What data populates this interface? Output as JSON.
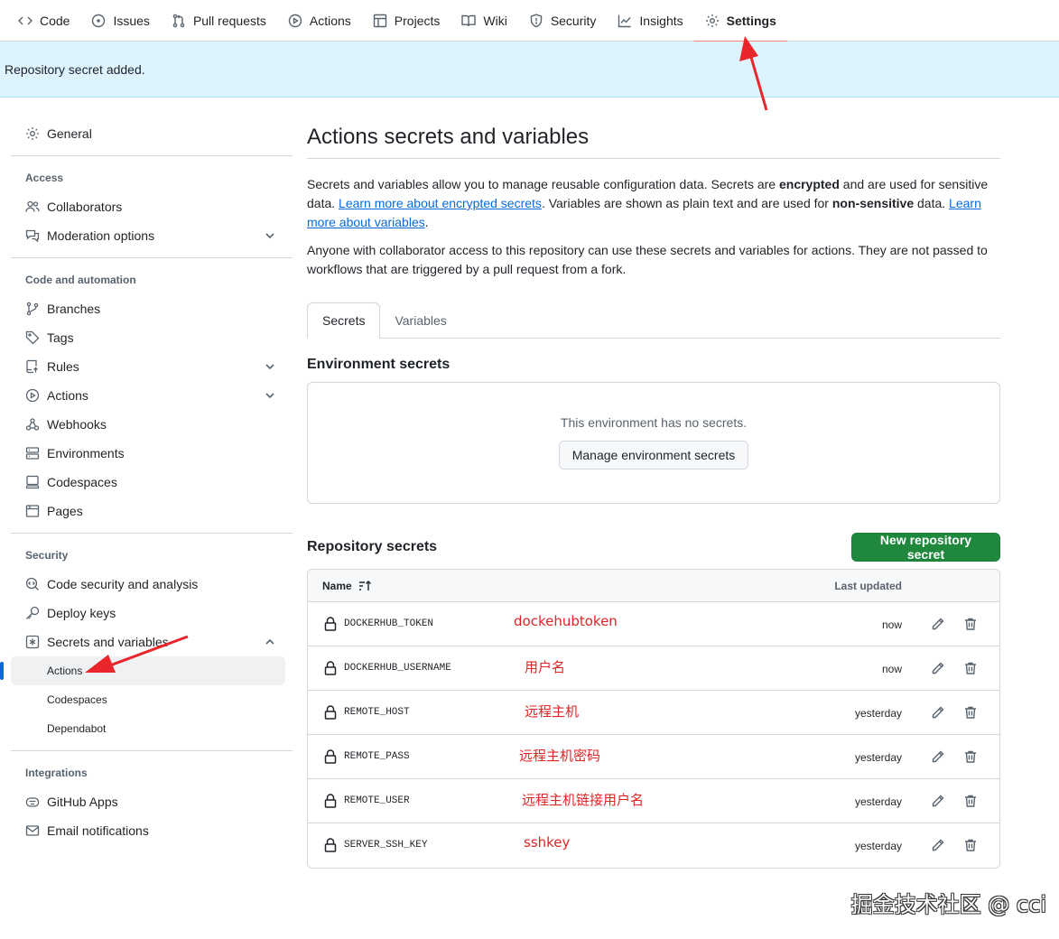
{
  "nav": {
    "items": [
      {
        "label": "Code",
        "icon": "code-icon"
      },
      {
        "label": "Issues",
        "icon": "issue-icon"
      },
      {
        "label": "Pull requests",
        "icon": "pull-request-icon"
      },
      {
        "label": "Actions",
        "icon": "play-icon"
      },
      {
        "label": "Projects",
        "icon": "table-icon"
      },
      {
        "label": "Wiki",
        "icon": "book-icon"
      },
      {
        "label": "Security",
        "icon": "shield-icon"
      },
      {
        "label": "Insights",
        "icon": "graph-icon"
      },
      {
        "label": "Settings",
        "icon": "gear-icon"
      }
    ],
    "active": "Settings"
  },
  "flash": {
    "message": "Repository secret added."
  },
  "sidebar": {
    "general": "General",
    "access_heading": "Access",
    "collaborators": "Collaborators",
    "moderation": "Moderation options",
    "code_heading": "Code and automation",
    "branches": "Branches",
    "tags": "Tags",
    "rules": "Rules",
    "actions": "Actions",
    "webhooks": "Webhooks",
    "environments": "Environments",
    "codespaces": "Codespaces",
    "pages": "Pages",
    "security_heading": "Security",
    "code_security": "Code security and analysis",
    "deploy_keys": "Deploy keys",
    "secrets_vars": "Secrets and variables",
    "sub_actions": "Actions",
    "sub_codespaces": "Codespaces",
    "sub_dependabot": "Dependabot",
    "integrations_heading": "Integrations",
    "github_apps": "GitHub Apps",
    "email_notifications": "Email notifications"
  },
  "main": {
    "title": "Actions secrets and variables",
    "desc_1": "Secrets and variables allow you to manage reusable configuration data. Secrets are ",
    "desc_bold_1": "encrypted",
    "desc_2": " and are used for sensitive data. ",
    "desc_link_1": "Learn more about encrypted secrets",
    "desc_3": ". Variables are shown as plain text and are used for ",
    "desc_bold_2": "non-sensitive",
    "desc_4": " data. ",
    "desc_link_2": "Learn more about variables",
    "desc_5": ".",
    "desc_second": "Anyone with collaborator access to this repository can use these secrets and variables for actions. They are not passed to workflows that are triggered by a pull request from a fork.",
    "tab_secrets": "Secrets",
    "tab_variables": "Variables",
    "env_title": "Environment secrets",
    "env_empty": "This environment has no secrets.",
    "env_button": "Manage environment secrets",
    "repo_title": "Repository secrets",
    "new_button": "New repository secret",
    "col_name": "Name",
    "col_updated": "Last updated"
  },
  "secrets": [
    {
      "name": "DOCKERHUB_TOKEN",
      "updated": "now",
      "note": "dockehubtoken"
    },
    {
      "name": "DOCKERHUB_USERNAME",
      "updated": "now",
      "note": "用户名"
    },
    {
      "name": "REMOTE_HOST",
      "updated": "yesterday",
      "note": "远程主机"
    },
    {
      "name": "REMOTE_PASS",
      "updated": "yesterday",
      "note": "远程主机密码"
    },
    {
      "name": "REMOTE_USER",
      "updated": "yesterday",
      "note": "远程主机链接用户名"
    },
    {
      "name": "SERVER_SSH_KEY",
      "updated": "yesterday",
      "note": "sshkey"
    }
  ],
  "watermark": "掘金技术社区 @ cci",
  "colors": {
    "accent": "#0969da",
    "primary_button": "#1f883d",
    "annotation": "#e02424",
    "flash_bg": "#ddf4ff",
    "active_tab_underline": "#fd8c73"
  }
}
